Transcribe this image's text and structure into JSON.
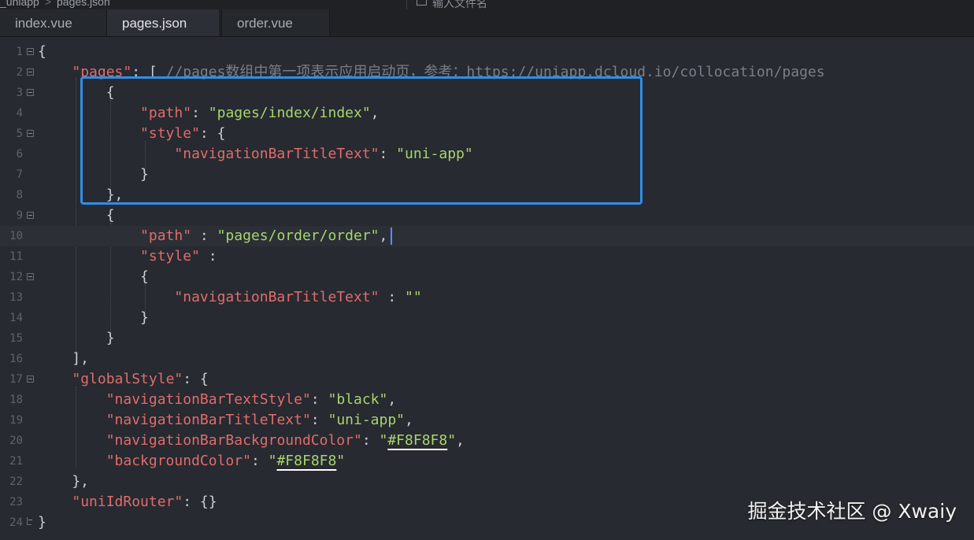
{
  "breadcrumb": {
    "project": "_uniapp",
    "separator": ">",
    "file": "pages.json"
  },
  "search": {
    "placeholder": "输入文件名"
  },
  "tabs": [
    {
      "label": "index.vue",
      "active": false
    },
    {
      "label": "pages.json",
      "active": true
    },
    {
      "label": "order.vue",
      "active": false
    }
  ],
  "editor": {
    "cursor_line": 10,
    "lines": [
      {
        "n": "1"
      },
      {
        "n": "2"
      },
      {
        "n": "3"
      },
      {
        "n": "4"
      },
      {
        "n": "5"
      },
      {
        "n": "6"
      },
      {
        "n": "7"
      },
      {
        "n": "8"
      },
      {
        "n": "9"
      },
      {
        "n": "10"
      },
      {
        "n": "11"
      },
      {
        "n": "12"
      },
      {
        "n": "13"
      },
      {
        "n": "14"
      },
      {
        "n": "15"
      },
      {
        "n": "16"
      },
      {
        "n": "17"
      },
      {
        "n": "18"
      },
      {
        "n": "19"
      },
      {
        "n": "20"
      },
      {
        "n": "21"
      },
      {
        "n": "22"
      },
      {
        "n": "23"
      },
      {
        "n": "24"
      }
    ],
    "tokens": {
      "pages_key": "\"pages\"",
      "pages_comment": "//pages数组中第一项表示应用启动页，参考：https://uniapp.dcloud.io/collocation/pages",
      "path_key": "\"path\"",
      "index_path": "\"pages/index/index\"",
      "style_key": "\"style\"",
      "navtitle_key": "\"navigationBarTitleText\"",
      "uniapp_val": "\"uni-app\"",
      "order_path": "\"pages/order/order\"",
      "empty_val": "\"\"",
      "globalstyle_key": "\"globalStyle\"",
      "navtextstyle_key": "\"navigationBarTextStyle\"",
      "black_val": "\"black\"",
      "navbg_key": "\"navigationBarBackgroundColor\"",
      "color_val": "#F8F8F8",
      "bg_key": "\"backgroundColor\"",
      "uniidrouter_key": "\"uniIdRouter\""
    }
  },
  "watermark": "掘金技术社区 @ Xwaiy",
  "colors": {
    "background": "#272a30",
    "key": "#e06c6c",
    "string": "#a8d46f",
    "comment": "#7a7f87",
    "highlight_box": "#2f8ee8",
    "caret": "#5b8cff"
  }
}
